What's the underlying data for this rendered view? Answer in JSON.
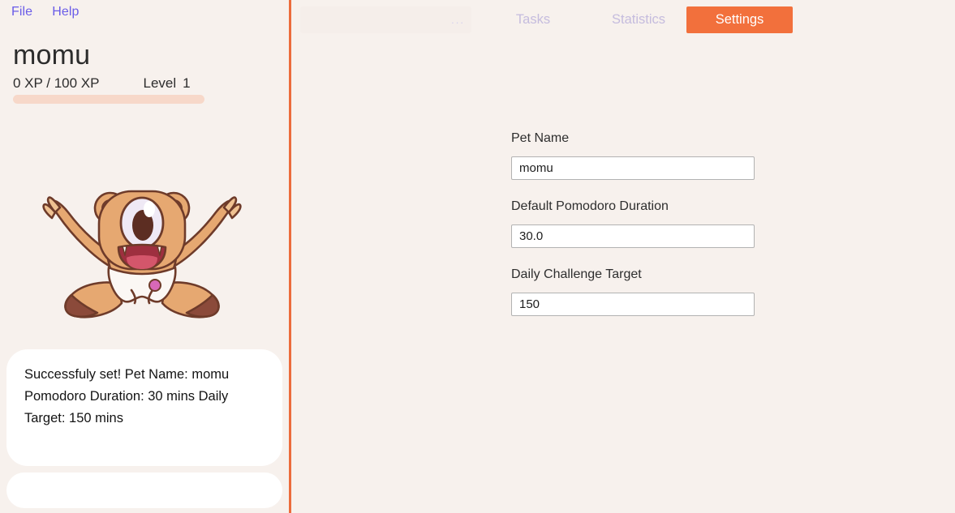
{
  "window": {
    "background_color": "#f7f1ed",
    "accent_color": "#ec6c3c",
    "menu_color": "#6a5ce8"
  },
  "menubar": {
    "items": [
      {
        "label": "File",
        "name": "menu-file"
      },
      {
        "label": "Help",
        "name": "menu-help"
      }
    ]
  },
  "pet": {
    "name": "momu",
    "xp_text": "0 XP / 100 XP",
    "xp_current": 0,
    "xp_max": 100,
    "xp_percent": 0,
    "level_label": "Level",
    "level_value": "1",
    "sprite_name": "bear-cub-cyclops-mascot"
  },
  "chat": {
    "message": "Successfuly set! Pet Name: momu\nPomodoro Duration: 30 mins Daily\nTarget: 150 mins",
    "input_value": "",
    "input_placeholder": ""
  },
  "tabs": [
    {
      "label": "...",
      "name": "tab-overflow",
      "active": false
    },
    {
      "label": "Tasks",
      "name": "tab-tasks",
      "active": false
    },
    {
      "label": "Statistics",
      "name": "tab-statistics",
      "active": false
    },
    {
      "label": "Settings",
      "name": "tab-settings",
      "active": true
    }
  ],
  "settings": {
    "pet_name": {
      "label": "Pet Name",
      "value": "momu",
      "placeholder": ""
    },
    "pomodoro_duration": {
      "label": "Default Pomodoro Duration",
      "value": "30.0",
      "placeholder": ""
    },
    "daily_target": {
      "label": "Daily Challenge Target",
      "value": "150",
      "placeholder": ""
    }
  }
}
